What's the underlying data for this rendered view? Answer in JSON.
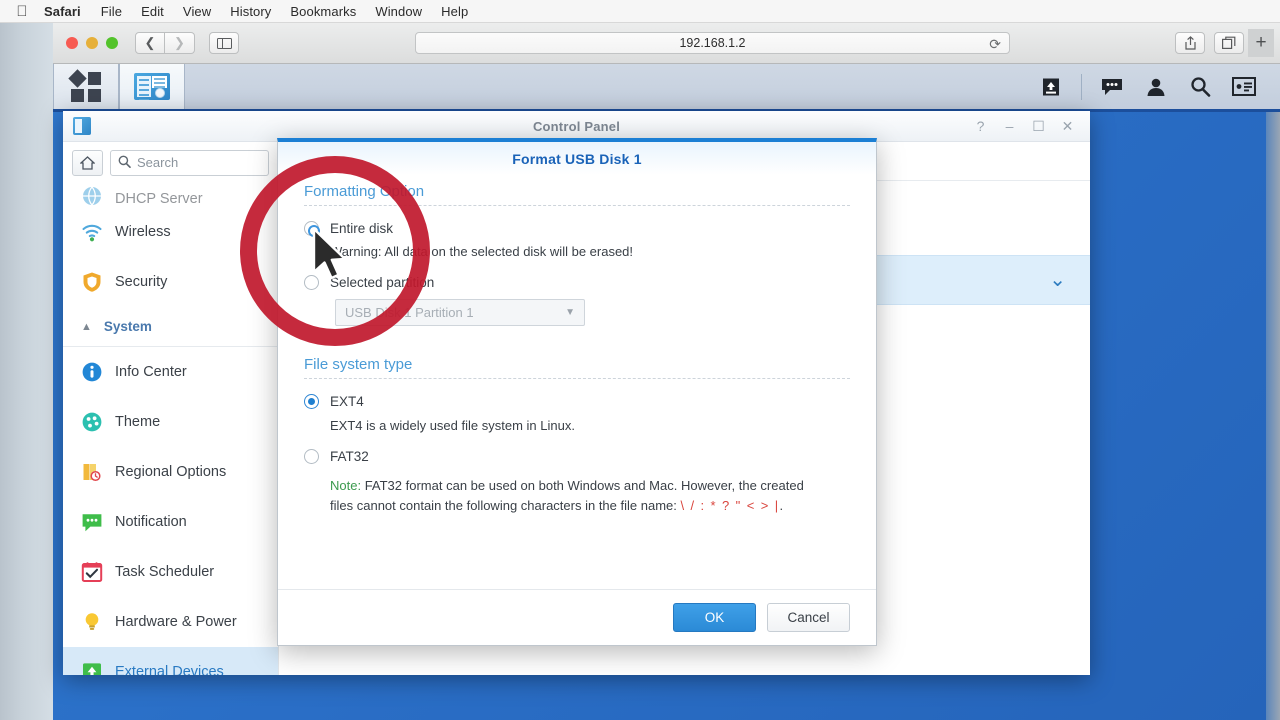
{
  "menubar": {
    "apple": "",
    "items": [
      {
        "label": "Safari",
        "bold": true
      },
      {
        "label": "File",
        "bold": false
      },
      {
        "label": "Edit",
        "bold": false
      },
      {
        "label": "View",
        "bold": false
      },
      {
        "label": "History",
        "bold": false
      },
      {
        "label": "Bookmarks",
        "bold": false
      },
      {
        "label": "Window",
        "bold": false
      },
      {
        "label": "Help",
        "bold": false
      }
    ]
  },
  "browser": {
    "url": "192.168.1.2",
    "reload_icon": "reload-icon",
    "back_icon": "chevron-left-icon",
    "forward_icon": "chevron-right-icon",
    "sidebar_icon": "sidebar-toggle-icon",
    "share_icon": "share-icon",
    "tabs_icon": "show-tabs-icon",
    "newtab_label": "+"
  },
  "dsm_taskbar": {
    "main_menu_icon": "app-grid-icon",
    "control_panel_icon": "control-panel-icon",
    "right_icons": [
      {
        "name": "upload-queue-icon"
      },
      {
        "name": "notifications-icon"
      },
      {
        "name": "user-account-icon"
      },
      {
        "name": "search-icon"
      },
      {
        "name": "widgets-icon"
      }
    ]
  },
  "control_panel": {
    "title": "Control Panel",
    "window_buttons": [
      {
        "name": "help-button",
        "glyph": "?"
      },
      {
        "name": "minimize-button",
        "glyph": "–"
      },
      {
        "name": "maximize-button",
        "glyph": "☐"
      },
      {
        "name": "close-button",
        "glyph": "✕"
      }
    ],
    "home_icon": "home-icon",
    "search_placeholder": "Search",
    "sidebar": {
      "items": [
        {
          "label": "DHCP Server",
          "icon": "dhcp-server-icon",
          "state": "cut-off"
        },
        {
          "label": "Wireless",
          "icon": "wireless-icon",
          "state": "normal"
        },
        {
          "label": "Security",
          "icon": "security-shield-icon",
          "state": "normal"
        }
      ],
      "group_label": "System",
      "group_icon": "chevron-up-icon",
      "system_items": [
        {
          "label": "Info Center",
          "icon": "info-center-icon",
          "state": "normal"
        },
        {
          "label": "Theme",
          "icon": "theme-palette-icon",
          "state": "normal"
        },
        {
          "label": "Regional Options",
          "icon": "regional-options-icon",
          "state": "normal"
        },
        {
          "label": "Notification",
          "icon": "notification-icon",
          "state": "normal"
        },
        {
          "label": "Task Scheduler",
          "icon": "task-scheduler-icon",
          "state": "normal"
        },
        {
          "label": "Hardware & Power",
          "icon": "hardware-power-icon",
          "state": "normal"
        },
        {
          "label": "External Devices",
          "icon": "external-devices-icon",
          "state": "selected"
        }
      ]
    },
    "content": {
      "collapse_chevron": "chevron-down-icon"
    }
  },
  "dialog": {
    "title": "Format USB Disk 1",
    "formatting_option": {
      "section_title": "Formatting Option",
      "entire_disk": {
        "label": "Entire disk",
        "selected": true
      },
      "warning": "Warning: All data on the selected disk will be erased!",
      "selected_partition": {
        "label": "Selected partition",
        "selected": false
      },
      "partition_select": {
        "value": "USB Disk 1 Partition 1",
        "arrow_icon": "chevron-down-icon",
        "disabled": true
      }
    },
    "file_system_type": {
      "section_title": "File system type",
      "ext4": {
        "label": "EXT4",
        "selected": true,
        "description": "EXT4 is a widely used file system in Linux."
      },
      "fat32": {
        "label": "FAT32",
        "selected": false
      },
      "note_keyword": "Note:",
      "note_text_1": " FAT32 format can be used on both Windows and Mac. However, the created",
      "note_text_2": "files cannot contain the following characters in the file name: ",
      "note_chars": "\\ / : * ? \" < > |",
      "note_period": "."
    },
    "buttons": {
      "ok": "OK",
      "cancel": "Cancel"
    }
  },
  "annotation": {
    "circle_color": "#c0182d",
    "cursor_icon": "mouse-pointer-icon"
  },
  "colors": {
    "accent_blue": "#1b7fd4",
    "desktop_blue": "#2a6ec6",
    "selected_item": "#d7e9f8",
    "note_green": "#3c9a4e",
    "note_red": "#d9443c"
  }
}
